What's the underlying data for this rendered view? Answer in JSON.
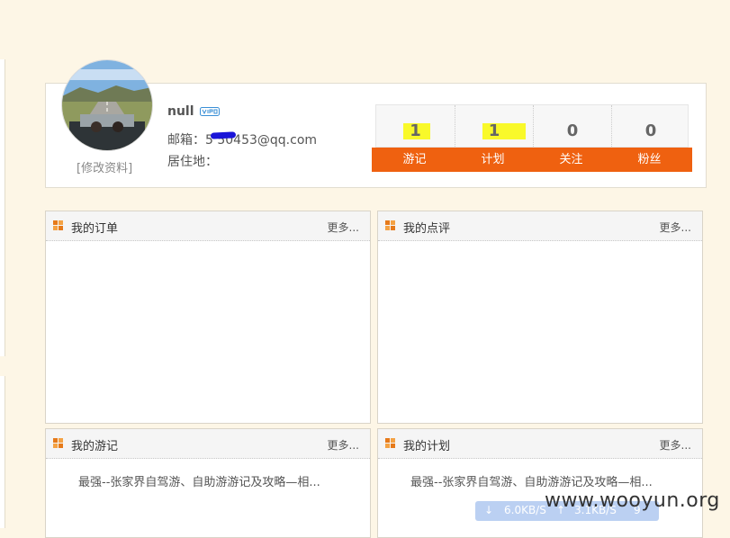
{
  "profile": {
    "username": "null",
    "edit_link": "[修改资料]",
    "email_label": "邮箱：",
    "email_value": "5    50453@qq.com",
    "residence_label": "居住地："
  },
  "stats": [
    {
      "label": "游记",
      "value": "1"
    },
    {
      "label": "计划",
      "value": "1"
    },
    {
      "label": "关注",
      "value": "0"
    },
    {
      "label": "粉丝",
      "value": "0"
    }
  ],
  "panels": {
    "orders": {
      "title": "我的订单",
      "more": "更多..."
    },
    "reviews": {
      "title": "我的点评",
      "more": "更多..."
    },
    "travelogues": {
      "title": "我的游记",
      "more": "更多...",
      "item": "最强--张家界自驾游、自助游游记及攻略—相..."
    },
    "plans": {
      "title": "我的计划",
      "more": "更多...",
      "item": "最强--张家界自驾游、自助游游记及攻略—相..."
    }
  },
  "netbar": {
    "download": "6.0KB/S",
    "upload": "3.1KB/S",
    "percent": "9"
  },
  "watermark": "www.wooyun.org",
  "colors": {
    "accent": "#ef6110",
    "highlight": "#f9f92a",
    "background": "#fdf6e6"
  }
}
